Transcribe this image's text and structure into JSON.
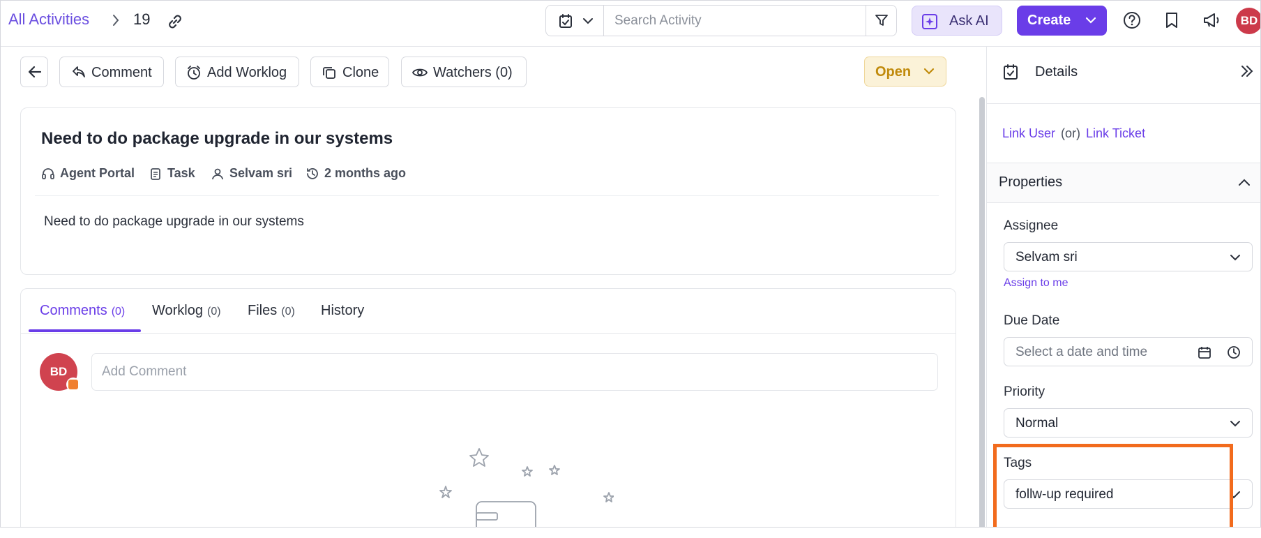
{
  "header": {
    "breadcrumb_root": "All Activities",
    "activity_id": "19",
    "search": {
      "placeholder": "Search Activity",
      "value": ""
    },
    "ask_ai_label": "Ask AI",
    "create_label": "Create",
    "user_initials": "BD",
    "icons": [
      "chevron-right-icon",
      "link-icon",
      "task-icon",
      "chevron-down-icon",
      "filter-icon",
      "sparkle-icon",
      "help-icon",
      "bookmark-icon",
      "announcement-icon"
    ]
  },
  "toolbar": {
    "comment_label": "Comment",
    "add_worklog_label": "Add Worklog",
    "clone_label": "Clone",
    "watchers_label": "Watchers (0)",
    "status_label": "Open"
  },
  "ticket": {
    "title": "Need to do package upgrade in our systems",
    "meta": {
      "source": "Agent Portal",
      "type": "Task",
      "owner": "Selvam sri",
      "created": "2 months ago"
    },
    "description": "Need to do package upgrade in our systems"
  },
  "tabs": [
    {
      "label": "Comments",
      "count": "(0)"
    },
    {
      "label": "Worklog",
      "count": "(0)"
    },
    {
      "label": "Files",
      "count": "(0)"
    },
    {
      "label": "History",
      "count": ""
    }
  ],
  "comment_box": {
    "avatar_initials": "BD",
    "placeholder": "Add Comment"
  },
  "panel": {
    "title": "Details",
    "link_user": "Link User",
    "or_text": "(or)",
    "link_ticket": "Link Ticket",
    "properties_title": "Properties",
    "assignee_label": "Assignee",
    "assignee_value": "Selvam sri",
    "assign_to_me": "Assign to me",
    "due_date_label": "Due Date",
    "due_date_placeholder": "Select a date and time",
    "priority_label": "Priority",
    "priority_value": "Normal",
    "tags_label": "Tags",
    "tags_value": "follw-up required"
  },
  "colors": {
    "accent": "#6a3de8",
    "status_open": "#c08a0b",
    "highlight": "#f26b1d",
    "avatar": "#cc3a4a"
  }
}
